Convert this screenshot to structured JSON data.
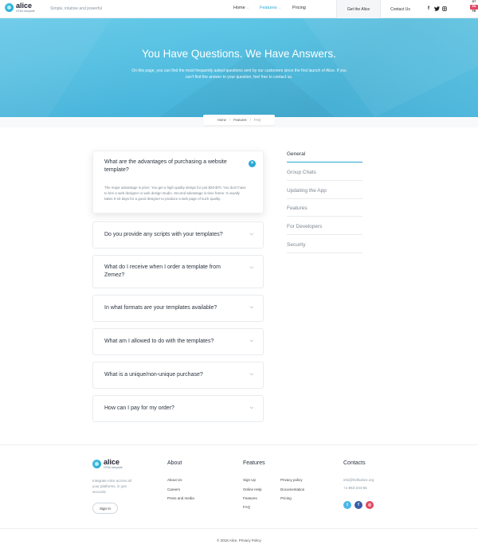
{
  "brand": {
    "name": "alice",
    "sub": "HTML template",
    "tagline": "Simple, intuitive and powerful"
  },
  "nav": {
    "home": "Home",
    "features": "Features",
    "pricing": "Pricing"
  },
  "header": {
    "get_alice": "Get the Alice",
    "contact": "Contact Us"
  },
  "social_icons": [
    "facebook-icon",
    "twitter-icon",
    "instagram-icon"
  ],
  "lang": {
    "items": [
      "DT",
      "EN",
      "FR"
    ],
    "current": "EN"
  },
  "hero": {
    "title": "You Have Questions. We Have Answers.",
    "description": "On this page, you can find the most frequently asked questions sent by our customers since the first launch of Alice. If you can't find the answer to your question, feel free to contact us."
  },
  "breadcrumb": {
    "home": "Home",
    "features": "Features",
    "current": "FAQ"
  },
  "faq": [
    {
      "q": "What are the advantages of purchasing a website template?",
      "a": "The major advantage is price: You get a high quality design for just $20-$70. You don't have to hire a web designer or web design studio. Second advantage is time frame: It usually takes 5-15 days for a good designer to produce a web page of such quality."
    },
    {
      "q": "Do you provide any scripts with your templates?"
    },
    {
      "q": "What do I receive when I order a template from Zemez?"
    },
    {
      "q": "In what formats are your templates available?"
    },
    {
      "q": "What am I allowed to do with the templates?"
    },
    {
      "q": "What is a unique/non-unique purchase?"
    },
    {
      "q": "How can I pay for my order?"
    }
  ],
  "sidebar": [
    "General",
    "Group Chats",
    "Updating the App",
    "Features",
    "For Developers",
    "Security"
  ],
  "footer": {
    "description": "Integrate Alice across all your platforms, in just seconds",
    "signin": "Sign In",
    "about": {
      "title": "About",
      "links": [
        "About Us",
        "Careers",
        "Press and media"
      ]
    },
    "features": {
      "title": "Features",
      "col1": [
        "Sign Up",
        "Online Help",
        "Features",
        "FAQ"
      ],
      "col2": [
        "Privacy policy",
        "Documentation",
        "Pricing"
      ]
    },
    "contacts": {
      "title": "Contacts",
      "email": "info@hellsalice.org",
      "phone": "+1-853-234-65"
    },
    "social_colors": {
      "twitter": "#4bb7e8",
      "facebook": "#3a5ca8",
      "instagram": "#e5465f"
    },
    "copyright": "© 2018 Alice. Privacy Policy"
  },
  "colors": {
    "accent": "#2aa8d4",
    "hero": "#52bde0"
  }
}
